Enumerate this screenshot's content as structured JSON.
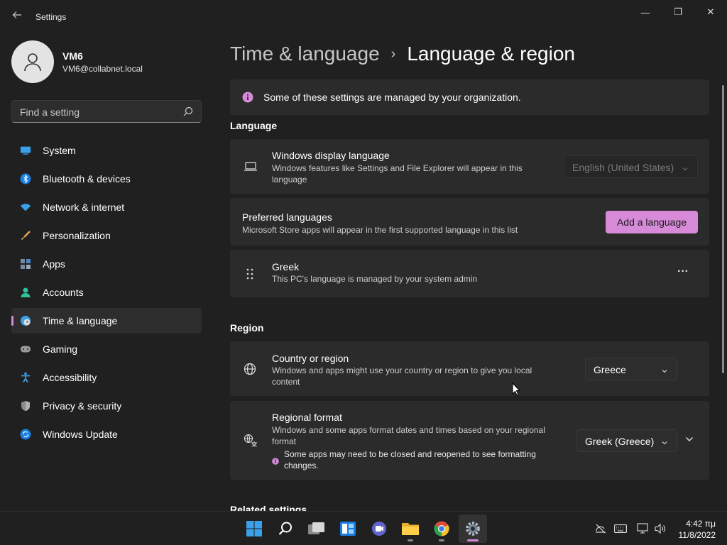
{
  "window": {
    "title": "Settings",
    "minimize_glyph": "—",
    "maximize_glyph": "❐",
    "close_glyph": "✕"
  },
  "profile": {
    "name": "VM6",
    "email": "VM6@collabnet.local"
  },
  "search": {
    "placeholder": "Find a setting"
  },
  "sidebar": {
    "items": [
      {
        "label": "System",
        "icon": "system-icon"
      },
      {
        "label": "Bluetooth & devices",
        "icon": "bluetooth-icon"
      },
      {
        "label": "Network & internet",
        "icon": "wifi-icon"
      },
      {
        "label": "Personalization",
        "icon": "brush-icon"
      },
      {
        "label": "Apps",
        "icon": "apps-icon"
      },
      {
        "label": "Accounts",
        "icon": "accounts-icon"
      },
      {
        "label": "Time & language",
        "icon": "globe-clock-icon",
        "active": true
      },
      {
        "label": "Gaming",
        "icon": "gamepad-icon"
      },
      {
        "label": "Accessibility",
        "icon": "accessibility-icon"
      },
      {
        "label": "Privacy & security",
        "icon": "shield-icon"
      },
      {
        "label": "Windows Update",
        "icon": "update-icon"
      }
    ]
  },
  "breadcrumb": {
    "parent": "Time & language",
    "separator": "›",
    "current": "Language & region"
  },
  "notice": {
    "text": "Some of these settings are managed by your organization.",
    "icon": "info-icon"
  },
  "language": {
    "section_title": "Language",
    "display_language": {
      "title": "Windows display language",
      "description": "Windows features like Settings and File Explorer will appear in this language",
      "value": "English (United States)"
    },
    "preferred": {
      "title": "Preferred languages",
      "description": "Microsoft Store apps will appear in the first supported language in this list",
      "button": "Add a language"
    },
    "greek": {
      "title": "Greek",
      "description": "This PC's language is managed by your system admin",
      "more": "···"
    }
  },
  "region": {
    "section_title": "Region",
    "country": {
      "title": "Country or region",
      "description": "Windows and apps might use your country or region to give you local content",
      "value": "Greece"
    },
    "format": {
      "title": "Regional format",
      "description": "Windows and some apps format dates and times based on your regional format",
      "value": "Greek (Greece)",
      "warning": "Some apps may need to be closed and reopened to see formatting changes."
    }
  },
  "related": {
    "section_title": "Related settings"
  },
  "taskbar": {
    "apps": [
      "windows-start-icon",
      "search-icon",
      "task-view-icon",
      "widgets-icon",
      "teams-chat-icon",
      "file-explorer-icon",
      "chrome-icon",
      "settings-icon"
    ],
    "time": "4:42 πμ",
    "date": "11/8/2022"
  },
  "colors": {
    "accent": "#d68ad8",
    "background": "#202020",
    "card": "#2b2b2b"
  }
}
